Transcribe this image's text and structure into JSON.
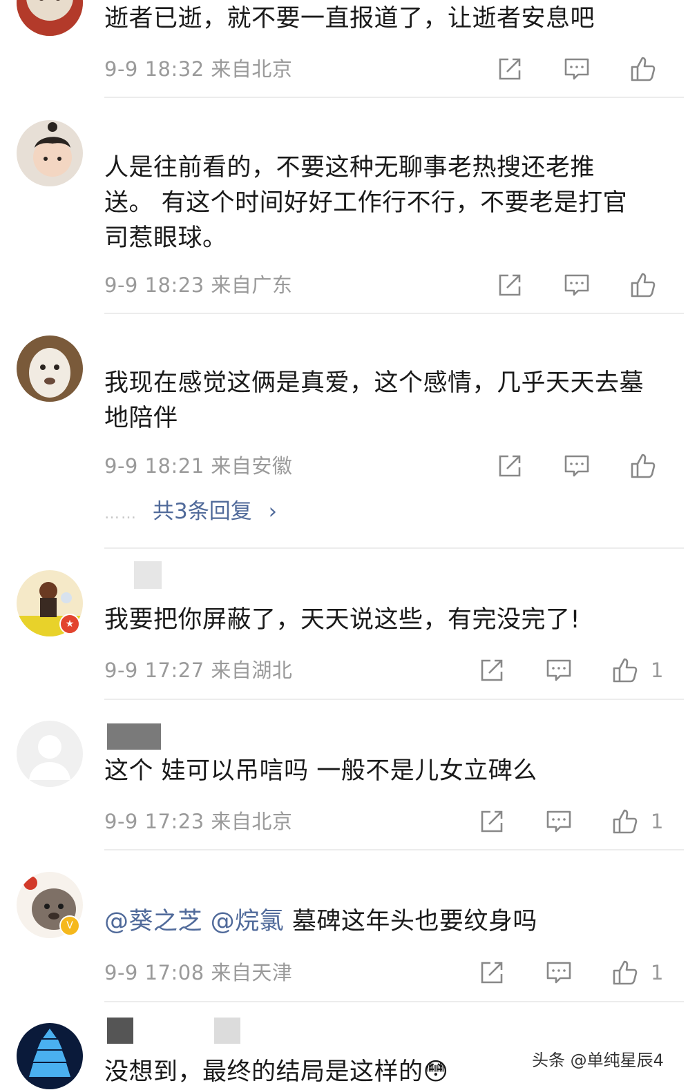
{
  "comments": [
    {
      "avatar_icon": "plush-toy-avatar",
      "text": "逝者已逝，就不要一直报道了，让逝者安息吧",
      "meta": "9-9 18:32 来自北京",
      "likes": ""
    },
    {
      "avatar_icon": "baby-photo-avatar",
      "text": "人是往前看的，不要这种无聊事老热搜还老推送。 有这个时间好好工作行不行，不要老是打官司惹眼球。",
      "meta": "9-9 18:23 来自广东",
      "likes": ""
    },
    {
      "avatar_icon": "alpaca-avatar",
      "text": "我现在感觉这俩是真爱，这个感情，几乎天天去墓地陪伴",
      "meta": "9-9 18:21 来自安徽",
      "likes": "",
      "replies_label": "共3条回复",
      "replies_dots": "……",
      "replies_arrow": "›"
    },
    {
      "avatar_icon": "figurine-avatar",
      "text": "我要把你屏蔽了，天天说这些，有完没完了!",
      "meta": "9-9 17:27 来自湖北",
      "likes": "1"
    },
    {
      "avatar_icon": "default-user-avatar",
      "text": "这个 娃可以吊唁吗 一般不是儿女立碑么",
      "meta": "9-9 17:23 来自北京",
      "likes": "1"
    },
    {
      "avatar_icon": "cartoon-bear-avatar",
      "mention1": "@葵之芝",
      "mention2": "@烷氯",
      "text": "墓碑这年头也要纹身吗",
      "meta": "9-9 17:08 来自天津",
      "likes": "1"
    },
    {
      "avatar_icon": "blue-pagoda-avatar",
      "text": "没想到，最终的结局是这样的😳",
      "meta": "",
      "likes": ""
    }
  ],
  "actions": {
    "share_icon": "share-icon",
    "comment_icon": "comment-icon",
    "like_icon": "thumbs-up-icon"
  },
  "watermark": "头条 @单纯星辰4",
  "colors": {
    "mention": "#506a9a",
    "meta": "#9a9a9a",
    "text": "#1a1a1a"
  }
}
